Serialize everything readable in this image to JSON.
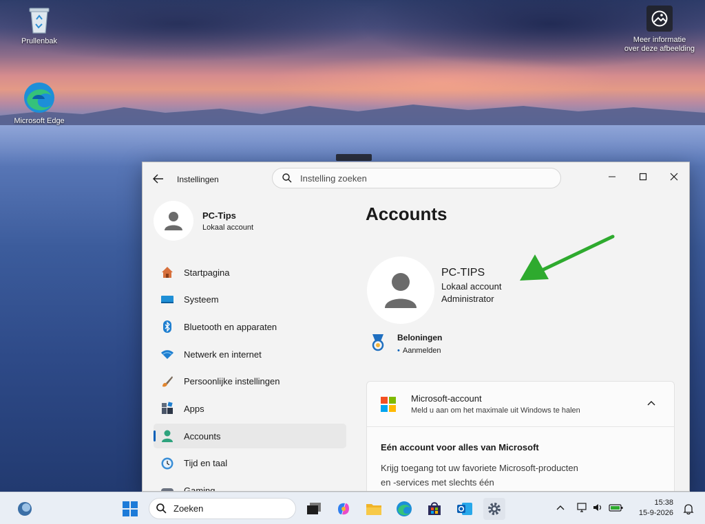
{
  "desktop": {
    "icons": [
      {
        "label": "Prullenbak"
      },
      {
        "label": "Microsoft Edge"
      }
    ],
    "info_label_line1": "Meer informatie",
    "info_label_line2": "over deze afbeelding"
  },
  "window": {
    "app_title": "Instellingen",
    "search_placeholder": "Instelling zoeken",
    "profile": {
      "name": "PC-Tips",
      "type": "Lokaal account"
    },
    "nav": [
      {
        "label": "Startpagina",
        "icon": "home-icon"
      },
      {
        "label": "Systeem",
        "icon": "system-icon"
      },
      {
        "label": "Bluetooth en apparaten",
        "icon": "bluetooth-icon"
      },
      {
        "label": "Netwerk en internet",
        "icon": "wifi-icon"
      },
      {
        "label": "Persoonlijke instellingen",
        "icon": "brush-icon"
      },
      {
        "label": "Apps",
        "icon": "apps-icon"
      },
      {
        "label": "Accounts",
        "icon": "accounts-icon",
        "active": true
      },
      {
        "label": "Tijd en taal",
        "icon": "time-language-icon"
      },
      {
        "label": "Gaming",
        "icon": "gaming-icon"
      }
    ],
    "page_title": "Accounts",
    "account": {
      "name": "PC-TIPS",
      "type": "Lokaal account",
      "role": "Administrator"
    },
    "rewards": {
      "title": "Beloningen",
      "action": "Aanmelden"
    },
    "ms_account": {
      "title": "Microsoft-account",
      "subtitle": "Meld u aan om het maximale uit Windows te halen",
      "body_title": "Eén account voor alles van Microsoft",
      "body_text": "Krijg toegang tot uw favoriete Microsoft-producten en -services met slechts één"
    }
  },
  "taskbar": {
    "search_label": "Zoeken",
    "time": "15:38",
    "date": "15-9-2026"
  },
  "colors": {
    "accent": "#005fb8",
    "arrow": "#2eaa2e",
    "window_bg": "#f3f3f3",
    "taskbar_bg": "#e9eef5"
  }
}
